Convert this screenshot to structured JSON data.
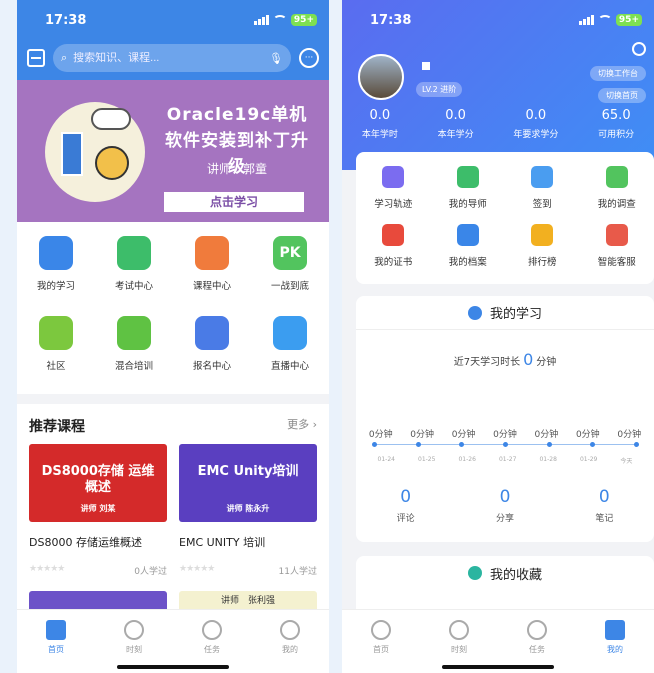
{
  "left": {
    "status": {
      "time": "17:38",
      "battery": "95+"
    },
    "search": {
      "placeholder": "搜索知识、课程..."
    },
    "banner": {
      "title_line1": "Oracle19c单机",
      "title_line2": "软件安装到补丁升级",
      "lecturer": "讲师　郭童",
      "button": "点击学习"
    },
    "grid": [
      {
        "label": "我的学习",
        "icon": "graduation-cap-icon",
        "color": "#3a86e8"
      },
      {
        "label": "考试中心",
        "icon": "exam-list-icon",
        "color": "#3dbd6a"
      },
      {
        "label": "课程中心",
        "icon": "books-icon",
        "color": "#f07b3c"
      },
      {
        "label": "一战到底",
        "icon": "pk-icon",
        "color": "#52c45e",
        "glyph": "PK"
      },
      {
        "label": "社区",
        "icon": "chat-bubble-icon",
        "color": "#7cc83e"
      },
      {
        "label": "混合培训",
        "icon": "shuffle-icon",
        "color": "#5fc243"
      },
      {
        "label": "报名中心",
        "icon": "clipboard-icon",
        "color": "#4a7be6"
      },
      {
        "label": "直播中心",
        "icon": "video-camera-icon",
        "color": "#3b9df0"
      }
    ],
    "recommend": {
      "title": "推荐课程",
      "more": "更多",
      "courses": [
        {
          "name": "DS8000 存储运维概述",
          "learners": "0人学过",
          "img_text": "DS8000存储 运维概述",
          "img_sub": "讲师 刘某",
          "color": "#d42a2a"
        },
        {
          "name": "EMC UNITY 培训",
          "learners": "11人学过",
          "img_text": "EMC Unity培训",
          "img_sub": "讲师 陈永升",
          "color": "#5a3fc0"
        }
      ],
      "next_lecturer": "讲师　张利强"
    },
    "tabs": [
      {
        "label": "首页",
        "active": true
      },
      {
        "label": "时刻",
        "active": false
      },
      {
        "label": "任务",
        "active": false
      },
      {
        "label": "我的",
        "active": false
      }
    ]
  },
  "right": {
    "status": {
      "time": "17:38",
      "battery": "95+"
    },
    "profile": {
      "level": "LV.2 进阶",
      "switch_workbench": "切换工作台",
      "switch_home": "切换首页"
    },
    "stats": [
      {
        "value": "0.0",
        "label": "本年学时"
      },
      {
        "value": "0.0",
        "label": "本年学分"
      },
      {
        "value": "0.0",
        "label": "年要求学分"
      },
      {
        "value": "65.0",
        "label": "可用积分"
      }
    ],
    "features": [
      {
        "label": "学习轨迹",
        "icon": "clock-icon",
        "color": "#7b6cf0"
      },
      {
        "label": "我的导师",
        "icon": "mentor-icon",
        "color": "#3dbd6a"
      },
      {
        "label": "签到",
        "icon": "checkin-icon",
        "color": "#4a9df0"
      },
      {
        "label": "我的调查",
        "icon": "survey-icon",
        "color": "#52c45e"
      },
      {
        "label": "我的证书",
        "icon": "certificate-icon",
        "color": "#e84a3c"
      },
      {
        "label": "我的档案",
        "icon": "archive-icon",
        "color": "#3a86e8"
      },
      {
        "label": "排行榜",
        "icon": "trophy-icon",
        "color": "#f2b020"
      },
      {
        "label": "智能客服",
        "icon": "service-icon",
        "color": "#e85a4a"
      }
    ],
    "my_study": {
      "title": "我的学习",
      "week_prefix": "近7天学习时长",
      "week_value": "0",
      "week_unit": "分钟",
      "daily": [
        "0分钟",
        "0分钟",
        "0分钟",
        "0分钟",
        "0分钟",
        "0分钟",
        "0分钟"
      ],
      "dates": [
        "01-24",
        "01-25",
        "01-26",
        "01-27",
        "01-28",
        "01-29",
        "今天"
      ],
      "counts": [
        {
          "value": "0",
          "label": "评论"
        },
        {
          "value": "0",
          "label": "分享"
        },
        {
          "value": "0",
          "label": "笔记"
        }
      ]
    },
    "favorites": {
      "title": "我的收藏"
    },
    "tabs": [
      {
        "label": "首页",
        "active": false
      },
      {
        "label": "时刻",
        "active": false
      },
      {
        "label": "任务",
        "active": false
      },
      {
        "label": "我的",
        "active": true
      }
    ]
  }
}
